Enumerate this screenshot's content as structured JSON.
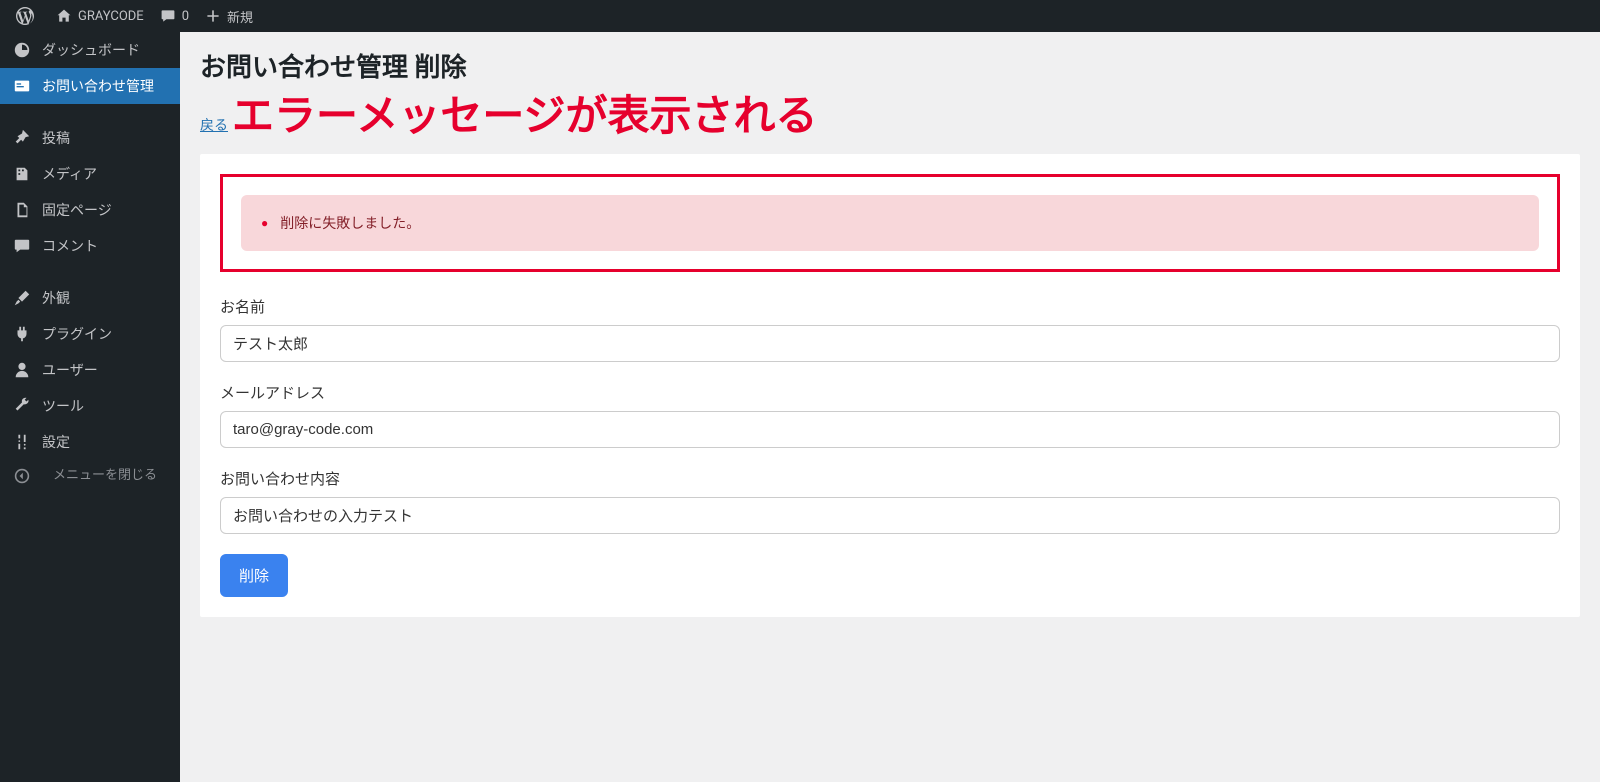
{
  "adminBar": {
    "siteTitle": "GRAYCODE",
    "commentCount": "0",
    "newLabel": "新規"
  },
  "sidebar": {
    "items": [
      {
        "label": "ダッシュボード"
      },
      {
        "label": "お問い合わせ管理"
      },
      {
        "label": "投稿"
      },
      {
        "label": "メディア"
      },
      {
        "label": "固定ページ"
      },
      {
        "label": "コメント"
      },
      {
        "label": "外観"
      },
      {
        "label": "プラグイン"
      },
      {
        "label": "ユーザー"
      },
      {
        "label": "ツール"
      },
      {
        "label": "設定"
      }
    ],
    "collapseLabel": "メニューを閉じる"
  },
  "page": {
    "heading": "お問い合わせ管理 削除",
    "backLink": "戻る",
    "annotation": "エラーメッセージが表示される"
  },
  "alert": {
    "message": "削除に失敗しました。"
  },
  "form": {
    "name": {
      "label": "お名前",
      "value": "テスト太郎"
    },
    "email": {
      "label": "メールアドレス",
      "value": "taro@gray-code.com"
    },
    "content": {
      "label": "お問い合わせ内容",
      "value": "お問い合わせの入力テスト"
    },
    "submit": "削除"
  }
}
